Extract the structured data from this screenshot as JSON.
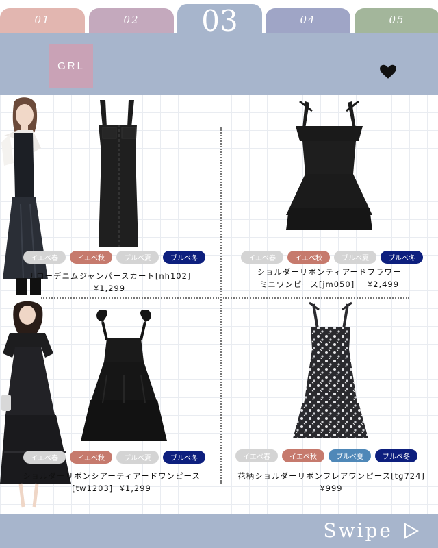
{
  "tabs": [
    {
      "label": "01",
      "color": "#e2b6b0"
    },
    {
      "label": "02",
      "color": "#c4a9bd"
    },
    {
      "label": "03",
      "color": "#a7b5cc"
    },
    {
      "label": "04",
      "color": "#9fa5c6"
    },
    {
      "label": "05",
      "color": "#a3b69b"
    }
  ],
  "brand": {
    "logo_text": "GRL"
  },
  "tag_colors": {
    "inactive": "#d4d4d4",
    "autumn": "#c67a6d",
    "summer": "#4f88b8",
    "winter": "#0d1f7e"
  },
  "products": [
    {
      "tags": [
        "イエベ春",
        "イエベ秋",
        "ブルベ夏",
        "ブルベ冬"
      ],
      "tag_states": [
        "inactive",
        "autumn",
        "inactive",
        "winter"
      ],
      "name": "ナローデニムジャンパースカート[nh102]",
      "price": "¥1,299"
    },
    {
      "tags": [
        "イエベ春",
        "イエベ秋",
        "ブルベ夏",
        "ブルベ冬"
      ],
      "tag_states": [
        "inactive",
        "autumn",
        "inactive",
        "winter"
      ],
      "name": "ショルダーリボンティアードフラワー",
      "name2": "ミニワンピース[jm050]",
      "price": "¥2,499"
    },
    {
      "tags": [
        "イエベ春",
        "イエベ秋",
        "ブルベ夏",
        "ブルベ冬"
      ],
      "tag_states": [
        "inactive",
        "autumn",
        "inactive",
        "winter"
      ],
      "name": "ショルダーリボンシアーティアードワンピース",
      "name2": "[tw1203]",
      "price": "¥1,299"
    },
    {
      "tags": [
        "イエベ春",
        "イエベ秋",
        "ブルベ夏",
        "ブルベ冬"
      ],
      "tag_states": [
        "inactive",
        "autumn",
        "summer",
        "winter"
      ],
      "name": "花柄ショルダーリボンフレアワンピース[tg724]",
      "price": "¥999"
    }
  ],
  "footer": {
    "swipe_label": "Swipe",
    "arrow_icon": "play-arrow-icon"
  }
}
